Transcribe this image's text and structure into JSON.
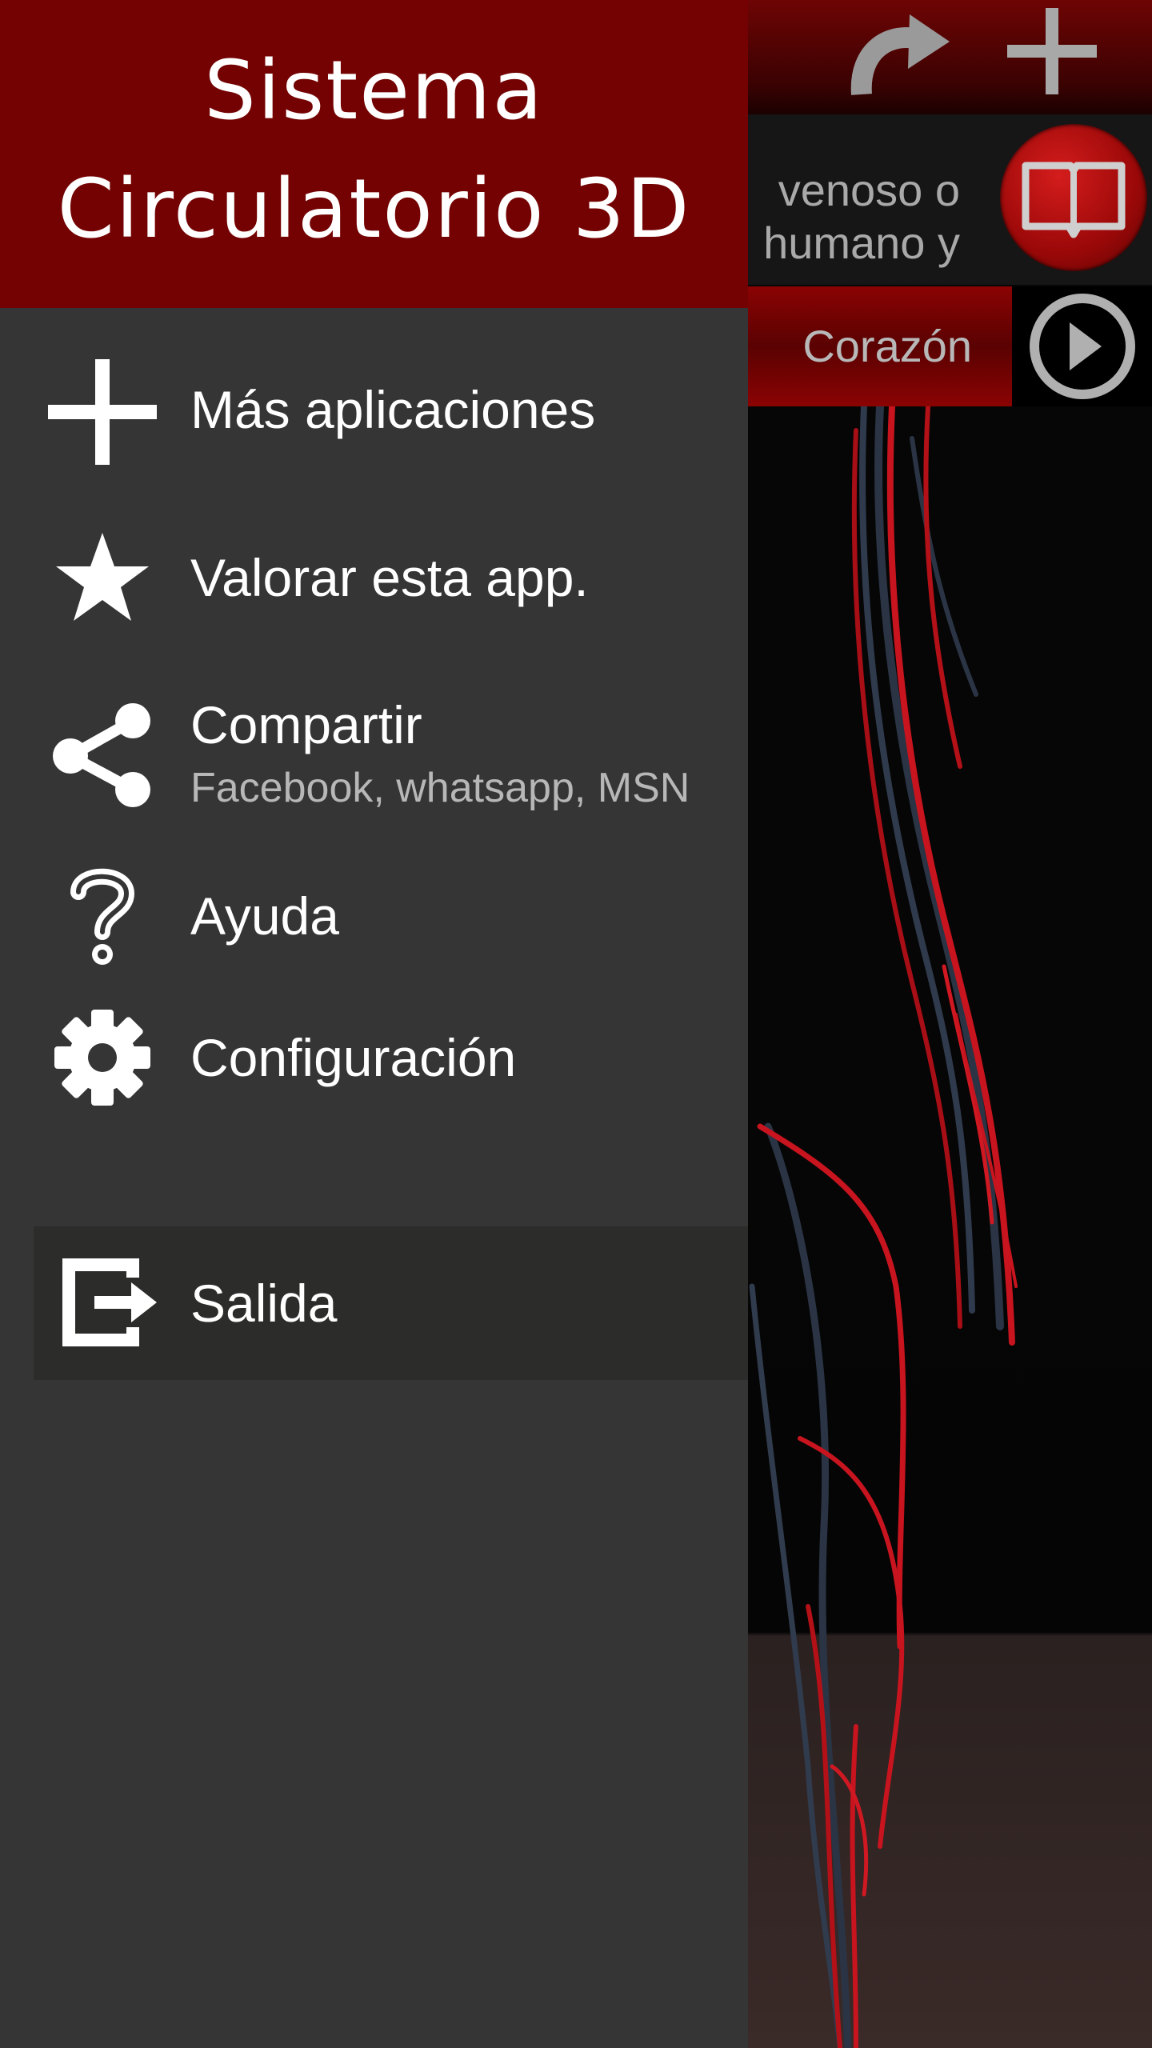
{
  "drawer": {
    "title_line1": "Sistema",
    "title_line2": "Circulatorio 3D",
    "items": [
      {
        "label": "Más aplicaciones",
        "icon": "plus-icon"
      },
      {
        "label": "Valorar esta app.",
        "icon": "star-icon"
      },
      {
        "label": "Compartir",
        "sublabel": "Facebook, whatsapp, MSN",
        "icon": "share-icon"
      },
      {
        "label": "Ayuda",
        "icon": "question-mark-icon"
      },
      {
        "label": "Configuración",
        "icon": "gear-icon"
      }
    ],
    "exit": {
      "label": "Salida",
      "icon": "exit-icon"
    }
  },
  "background": {
    "info_text_line1": "venoso o",
    "info_text_line2": "humano y",
    "part_label": "Corazón",
    "toolbar_icons": [
      "redo-icon",
      "plus-icon",
      "book-icon",
      "play-icon"
    ]
  },
  "colors": {
    "header_red": "#740202",
    "drawer_bg": "#363535",
    "exit_bg": "#2c2c2b",
    "vessel_red": "#c8141e",
    "vein_blue": "#2a3444"
  }
}
